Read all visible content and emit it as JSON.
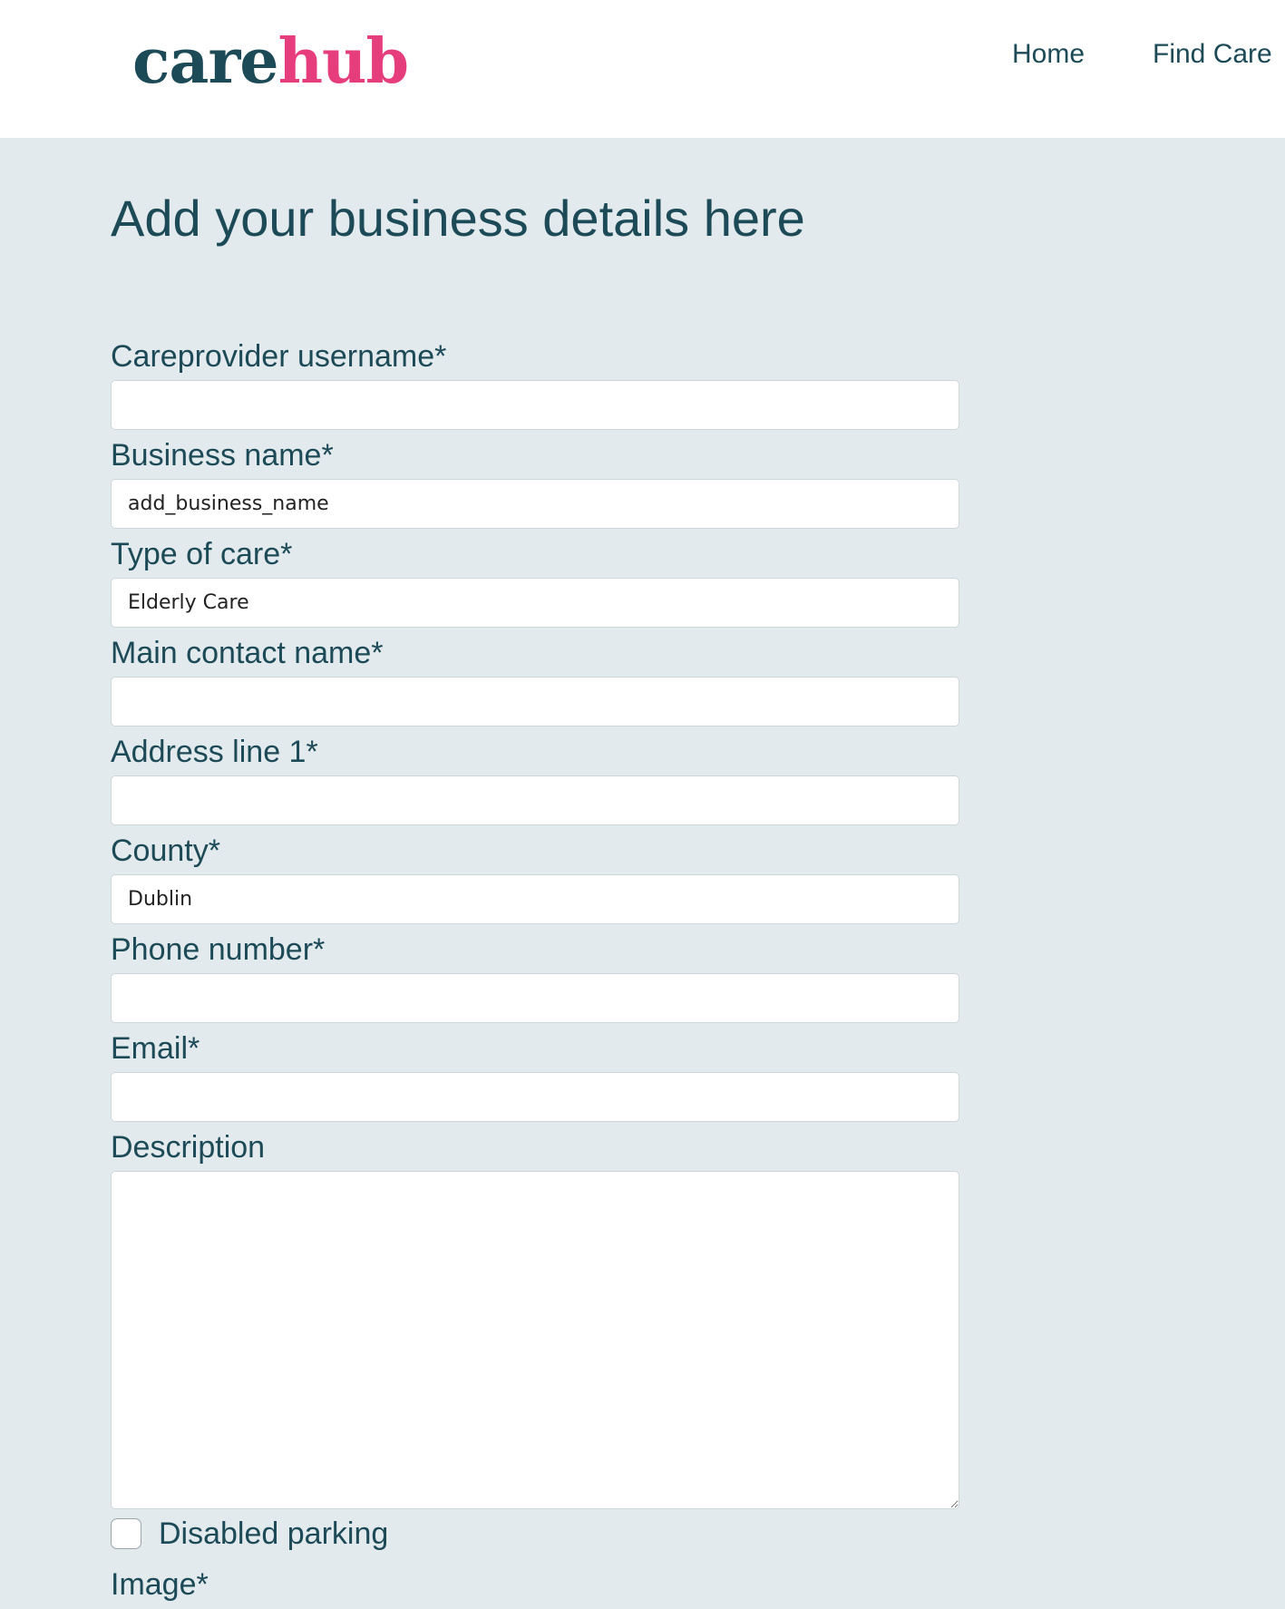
{
  "header": {
    "logo": {
      "part1": "care",
      "part2": "hub"
    },
    "nav": [
      {
        "label": "Home"
      },
      {
        "label": "Find Care"
      }
    ]
  },
  "page": {
    "title": "Add your business details here"
  },
  "form": {
    "careprovider_username": {
      "label": "Careprovider username*",
      "value": ""
    },
    "business_name": {
      "label": "Business name*",
      "value": "add_business_name"
    },
    "type_of_care": {
      "label": "Type of care*",
      "value": "Elderly Care"
    },
    "main_contact_name": {
      "label": "Main contact name*",
      "value": ""
    },
    "address_line_1": {
      "label": "Address line 1*",
      "value": ""
    },
    "county": {
      "label": "County*",
      "value": "Dublin"
    },
    "phone_number": {
      "label": "Phone number*",
      "value": ""
    },
    "email": {
      "label": "Email*",
      "value": ""
    },
    "description": {
      "label": "Description",
      "value": ""
    },
    "disabled_parking": {
      "label": "Disabled parking",
      "checked": false
    },
    "image": {
      "label": "Image*"
    }
  },
  "colors": {
    "brand_dark": "#1d4a57",
    "brand_pink": "#e63d7d",
    "page_background": "#e3eaee"
  }
}
